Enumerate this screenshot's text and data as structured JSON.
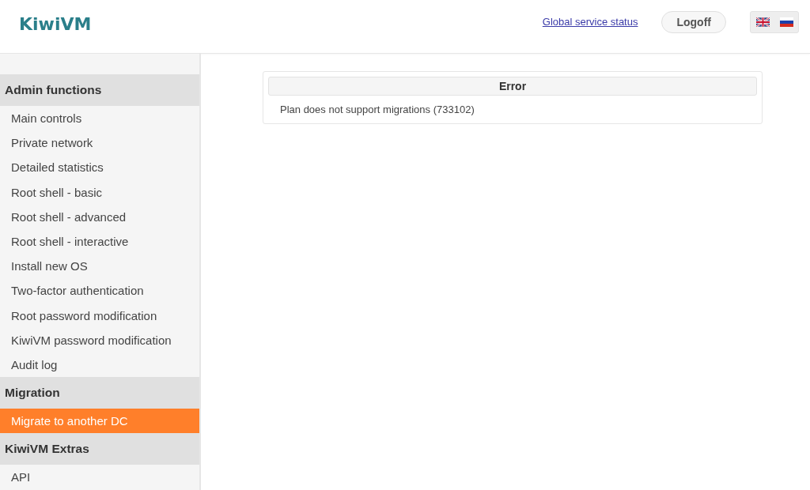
{
  "logo": "KiwiVM",
  "header": {
    "status_link": "Global service status",
    "logoff_button": "Logoff"
  },
  "sidebar": {
    "sections": [
      {
        "title": "Admin functions",
        "items": [
          {
            "label": "Main controls",
            "selected": false
          },
          {
            "label": "Private network",
            "selected": false
          },
          {
            "label": "Detailed statistics",
            "selected": false
          },
          {
            "label": "Root shell - basic",
            "selected": false
          },
          {
            "label": "Root shell - advanced",
            "selected": false
          },
          {
            "label": "Root shell - interactive",
            "selected": false
          },
          {
            "label": "Install new OS",
            "selected": false
          },
          {
            "label": "Two-factor authentication",
            "selected": false
          },
          {
            "label": "Root password modification",
            "selected": false
          },
          {
            "label": "KiwiVM password modification",
            "selected": false
          },
          {
            "label": "Audit log",
            "selected": false
          }
        ]
      },
      {
        "title": "Migration",
        "items": [
          {
            "label": "Migrate to another DC",
            "selected": true
          }
        ]
      },
      {
        "title": "KiwiVM Extras",
        "items": [
          {
            "label": "API",
            "selected": false
          }
        ]
      }
    ]
  },
  "error": {
    "title": "Error",
    "message": "Plan does not support migrations (733102)"
  }
}
